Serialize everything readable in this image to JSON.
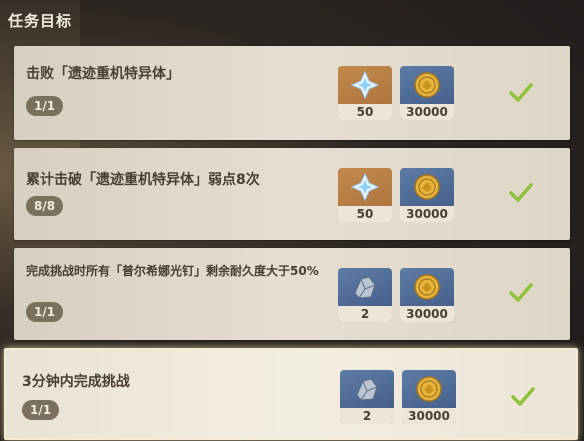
{
  "header": {
    "title": "任务目标"
  },
  "colors": {
    "card_bg": "#e6dfd1",
    "progress_bg": "#7b6f5e",
    "check_green": "#8fc13a",
    "reward_orange": "#b57c42",
    "reward_blue": "#4d6a94"
  },
  "tasks": [
    {
      "title": "击败「遗迹重机特异体」",
      "progress": "1/1",
      "completed": true,
      "rewards": [
        {
          "icon": "primogem-icon",
          "qty": "50"
        },
        {
          "icon": "mora-coin-icon",
          "qty": "30000"
        }
      ]
    },
    {
      "title": "累计击破「遗迹重机特异体」弱点8次",
      "progress": "8/8",
      "completed": true,
      "rewards": [
        {
          "icon": "primogem-icon",
          "qty": "50"
        },
        {
          "icon": "mora-coin-icon",
          "qty": "30000"
        }
      ]
    },
    {
      "title": "完成挑战时所有「普尔希娜光钉」剩余耐久度大于50%",
      "progress": "1/1",
      "completed": true,
      "rewards": [
        {
          "icon": "ore-material-icon",
          "qty": "2"
        },
        {
          "icon": "mora-coin-icon",
          "qty": "30000"
        }
      ]
    },
    {
      "title": "3分钟内完成挑战",
      "progress": "1/1",
      "completed": true,
      "rewards": [
        {
          "icon": "ore-material-icon",
          "qty": "2"
        },
        {
          "icon": "mora-coin-icon",
          "qty": "30000"
        }
      ]
    }
  ]
}
